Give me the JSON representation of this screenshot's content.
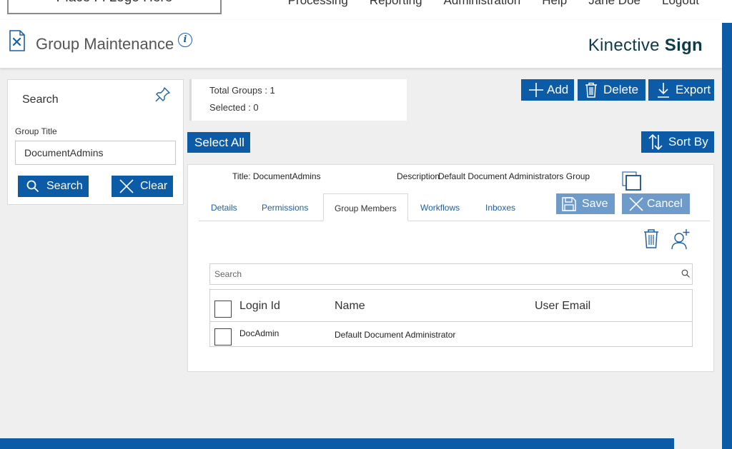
{
  "topnav": {
    "logo_text": "Place Fi Logo Here",
    "items": [
      "Processing",
      "Reporting",
      "Administration",
      "Help",
      "Jane Doe",
      "Logout"
    ]
  },
  "header": {
    "title": "Group Maintenance",
    "info_glyph": "i",
    "brand_light": "Kinective",
    "brand_bold": "Sign"
  },
  "search_panel": {
    "heading": "Search",
    "group_title_label": "Group Title",
    "group_title_value": "DocumentAdmins",
    "search_button": "Search",
    "clear_button": "Clear"
  },
  "totals": {
    "total_groups": "Total Groups : 1",
    "selected": "Selected : 0"
  },
  "toolbar": {
    "add": "Add",
    "delete": "Delete",
    "export": "Export",
    "select_all": "Select All",
    "sort_by": "Sort By"
  },
  "detail": {
    "title_line": "Title: DocumentAdmins",
    "description_label": "Description:",
    "description_value": "Default Document Administrators Group",
    "tabs": [
      {
        "label": "Details"
      },
      {
        "label": "Permissions"
      },
      {
        "label": "Group Members"
      },
      {
        "label": "Workflows"
      },
      {
        "label": "Inboxes"
      }
    ],
    "save": "Save",
    "cancel": "Cancel",
    "member_search_placeholder": "Search",
    "columns": [
      "Login Id",
      "Name",
      "User Email"
    ],
    "rows": [
      {
        "login_id": "DocAdmin",
        "name": "Default Document Administrator",
        "email": ""
      }
    ]
  },
  "colors": {
    "primary": "#0b5ba6",
    "disabled_button": "#6e9bc9",
    "brand_text": "#0e3a4a"
  }
}
